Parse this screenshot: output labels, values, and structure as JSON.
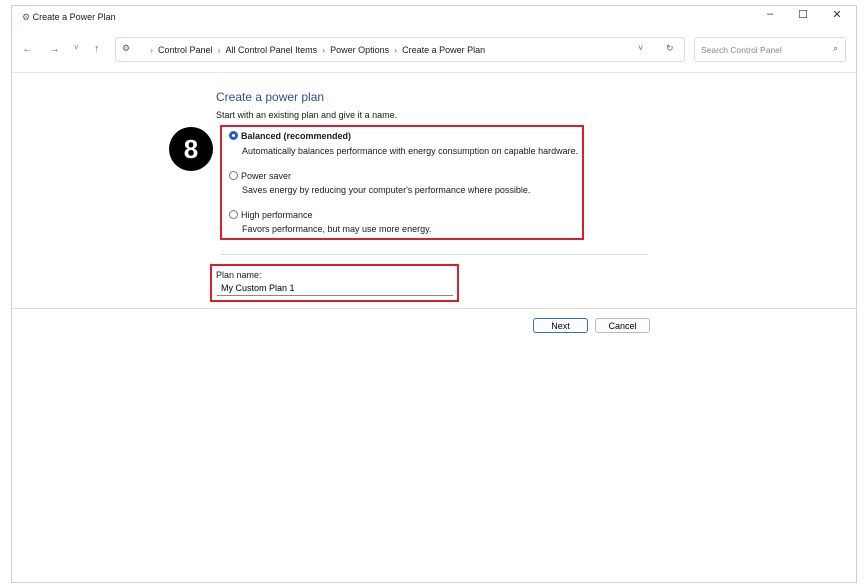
{
  "window": {
    "title": "Create a Power Plan"
  },
  "breadcrumb": [
    "Control Panel",
    "All Control Panel Items",
    "Power Options",
    "Create a Power Plan"
  ],
  "search": {
    "placeholder": "Search Control Panel"
  },
  "main": {
    "heading": "Create a power plan",
    "intro": "Start with an existing plan and give it a name.",
    "options": [
      {
        "label": "Balanced (recommended)",
        "desc": "Automatically balances performance with energy consumption on capable hardware.",
        "selected": true
      },
      {
        "label": "Power saver",
        "desc": "Saves energy by reducing your computer's performance where possible.",
        "selected": false
      },
      {
        "label": "High performance",
        "desc": "Favors performance, but may use more energy.",
        "selected": false
      }
    ],
    "plan_name_label": "Plan name:",
    "plan_name_value": "My Custom Plan 1"
  },
  "buttons": {
    "next": "Next",
    "cancel": "Cancel"
  },
  "annotation": {
    "step": "8"
  },
  "colors": {
    "accent": "#2f4d9e",
    "highlight": "#d81f2b"
  }
}
